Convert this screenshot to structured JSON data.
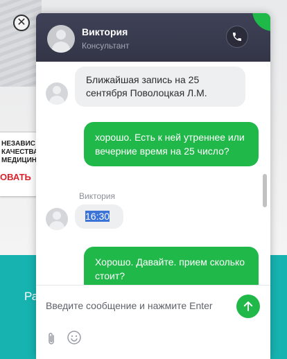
{
  "background": {
    "banner_lines": [
      "НЕЗАВИС",
      "КАЧЕСТВА",
      "МЕДИЦИН"
    ],
    "banner_red": "ОВАТЬ",
    "teal_text": "Ра",
    "close_glyph": "✕"
  },
  "header": {
    "name": "Виктория",
    "role": "Консультант",
    "call_icon": "phone-icon"
  },
  "messages": [
    {
      "direction": "in",
      "text": "Ближайшая запись на 25 сентября Поволоцкая Л.М."
    },
    {
      "direction": "out",
      "text": "хорошо. Есть к ней утреннее или вечерние время на 25 число?"
    },
    {
      "direction": "in",
      "sender": "Виктория",
      "text": "16:30",
      "selected": true
    },
    {
      "direction": "out",
      "text": "Хорошо. Давайте. прием сколько стоит?"
    }
  ],
  "composer": {
    "placeholder": "Введите сообщение и нажмите Enter",
    "value": "",
    "send_icon": "arrow-up-icon",
    "attach_icon": "paperclip-icon",
    "emoji_icon": "smile-icon"
  },
  "colors": {
    "header_bg": "#363849",
    "accent_green": "#21b84a",
    "incoming_bubble": "#eeeff1",
    "page_teal": "#17b3b0"
  }
}
